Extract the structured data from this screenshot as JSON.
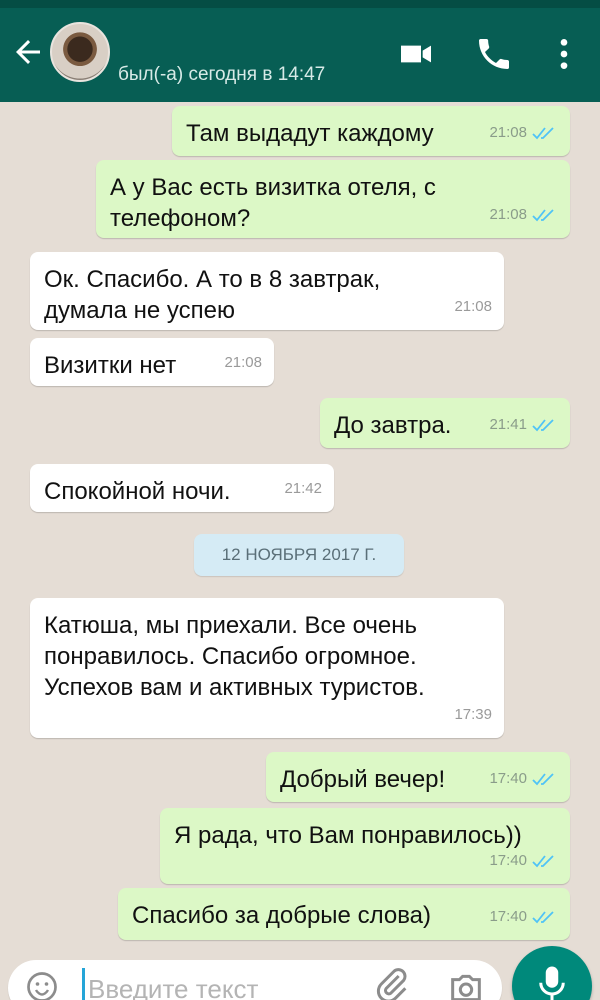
{
  "header": {
    "contact_status": "был(-а) сегодня в 14:47",
    "icons": [
      "back-arrow-icon",
      "contact-avatar",
      "video-call-icon",
      "phone-icon",
      "more-vert-icon"
    ],
    "color": "#075e54"
  },
  "messages": [
    {
      "direction": "out",
      "text": "Там выдадут каждому",
      "time": "21:08",
      "read": true
    },
    {
      "direction": "out",
      "text": "А у Вас есть визитка отеля, с телефоном?",
      "time": "21:08",
      "read": true
    },
    {
      "direction": "in",
      "text": "Ок. Спасибо. А то в 8 завтрак, думала не успею",
      "time": "21:08"
    },
    {
      "direction": "in",
      "text": "Визитки нет",
      "time": "21:08"
    },
    {
      "direction": "out",
      "text": "До завтра.",
      "time": "21:41",
      "read": true
    },
    {
      "direction": "in",
      "text": "Спокойной ночи.",
      "time": "21:42"
    },
    {
      "direction": "in",
      "text": "Катюша, мы приехали. Все очень понравилось. Спасибо огромное. Успехов вам и активных туристов.",
      "time": "17:39"
    },
    {
      "direction": "out",
      "text": "Добрый вечер!",
      "time": "17:40",
      "read": true
    },
    {
      "direction": "out",
      "text": "Я рада, что Вам понравилось))",
      "time": "17:40",
      "read": true
    },
    {
      "direction": "out",
      "text": "Спасибо за добрые слова)",
      "time": "17:40",
      "read": true
    }
  ],
  "date_separator": "12 НОЯБРЯ 2017 Г.",
  "composer": {
    "placeholder": "Введите текст",
    "icons": [
      "emoji-icon",
      "attach-icon",
      "camera-icon",
      "mic-icon"
    ]
  },
  "colors": {
    "outgoing_bubble": "#dcf8c6",
    "incoming_bubble": "#ffffff",
    "read_ticks": "#4fc3f7",
    "mic_button": "#00897b"
  }
}
